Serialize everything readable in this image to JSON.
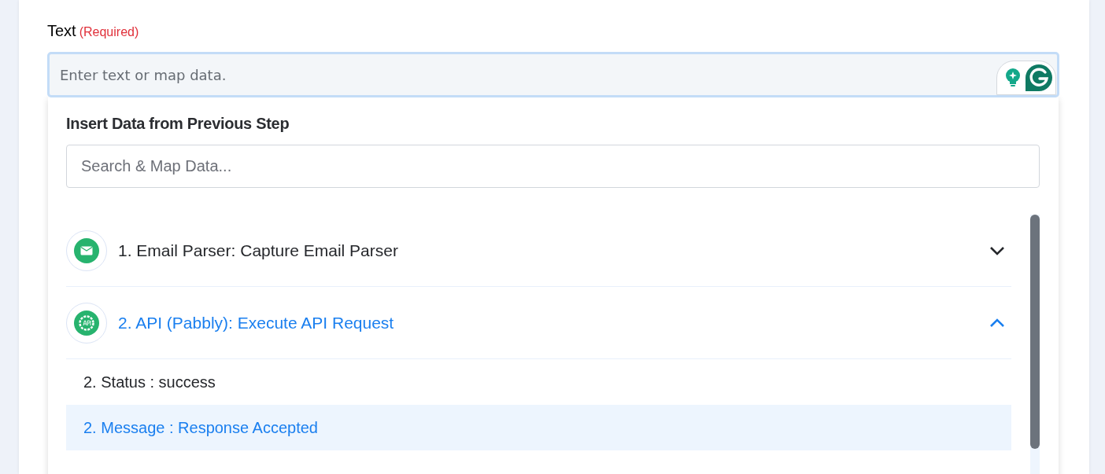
{
  "field": {
    "label": "Text",
    "required": "(Required)",
    "placeholder": "Enter text or map data."
  },
  "dropdown": {
    "title": "Insert Data from Previous Step",
    "search": {
      "placeholder": "Search & Map Data..."
    },
    "steps": [
      {
        "kind": "email",
        "label": "1. Email Parser: Capture Email Parser",
        "expanded": false
      },
      {
        "kind": "api",
        "label": "2. API (Pabbly): Execute API Request",
        "expanded": true,
        "children": [
          {
            "label": "2. Status : success",
            "selected": false
          },
          {
            "label": "2. Message : Response Accepted",
            "selected": true
          }
        ]
      }
    ]
  }
}
